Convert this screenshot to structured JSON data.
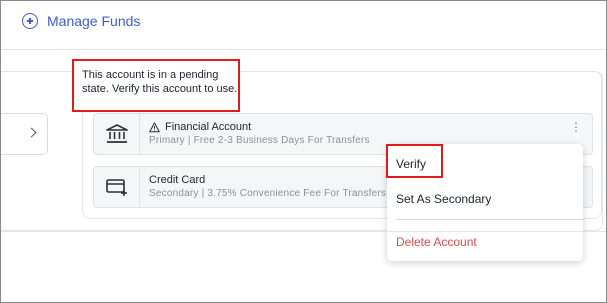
{
  "header": {
    "manage_funds_label": "Manage Funds"
  },
  "tooltip": {
    "text": "This account is in a pending state. Verify this account to use."
  },
  "accounts": [
    {
      "name": "Financial Account",
      "detail": "Primary  |  Free 2-3 Business Days For Transfers",
      "icon": "bank-icon",
      "status_icon": "warning-icon"
    },
    {
      "name": "Credit Card",
      "detail": "Secondary  |  3.75% Convenience Fee For Transfers",
      "icon": "credit-card-icon"
    }
  ],
  "menu": {
    "verify": "Verify",
    "set_secondary": "Set As Secondary",
    "delete": "Delete Account"
  },
  "colors": {
    "accent": "#3f5bd8",
    "highlight": "#e01b1b",
    "danger": "#e24b4b"
  }
}
